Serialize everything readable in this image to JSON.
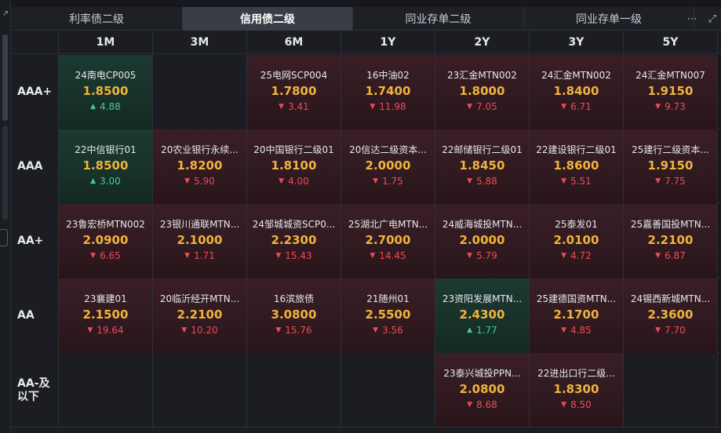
{
  "tabs": [
    {
      "label": "利率债二级",
      "active": false
    },
    {
      "label": "信用债二级",
      "active": true
    },
    {
      "label": "同业存单二级",
      "active": false
    },
    {
      "label": "同业存单一级",
      "active": false
    }
  ],
  "icons": {
    "more": "more-icon",
    "expand": "expand-icon",
    "corner": "corner-arrow-icon"
  },
  "colors": {
    "rate": "#f0b43c",
    "down": "#ef4b55",
    "up": "#3fd08a"
  },
  "columns": [
    "1M",
    "3M",
    "6M",
    "1Y",
    "2Y",
    "3Y",
    "5Y"
  ],
  "rows": [
    {
      "label": "AAA+",
      "cells": [
        {
          "name": "24南电CP005",
          "rate": "1.8500",
          "change": "4.88",
          "dir": "up"
        },
        null,
        {
          "name": "25电网SCP004",
          "rate": "1.7800",
          "change": "3.41",
          "dir": "down"
        },
        {
          "name": "16中油02",
          "rate": "1.7400",
          "change": "11.98",
          "dir": "down"
        },
        {
          "name": "23汇金MTN002",
          "rate": "1.8000",
          "change": "7.05",
          "dir": "down"
        },
        {
          "name": "24汇金MTN002",
          "rate": "1.8400",
          "change": "6.71",
          "dir": "down"
        },
        {
          "name": "24汇金MTN007",
          "rate": "1.9150",
          "change": "9.73",
          "dir": "down"
        }
      ]
    },
    {
      "label": "AAA",
      "cells": [
        {
          "name": "22中信银行01",
          "rate": "1.8500",
          "change": "3.00",
          "dir": "up"
        },
        {
          "name": "20农业银行永续...",
          "rate": "1.8200",
          "change": "5.90",
          "dir": "down"
        },
        {
          "name": "20中国银行二级01",
          "rate": "1.8100",
          "change": "4.00",
          "dir": "down"
        },
        {
          "name": "20信达二级资本...",
          "rate": "2.0000",
          "change": "1.75",
          "dir": "down"
        },
        {
          "name": "22邮储银行二级01",
          "rate": "1.8450",
          "change": "5.88",
          "dir": "down"
        },
        {
          "name": "22建设银行二级01",
          "rate": "1.8600",
          "change": "5.51",
          "dir": "down"
        },
        {
          "name": "25建行二级资本...",
          "rate": "1.9150",
          "change": "7.75",
          "dir": "down"
        }
      ]
    },
    {
      "label": "AA+",
      "cells": [
        {
          "name": "23鲁宏桥MTN002",
          "rate": "2.0900",
          "change": "6.65",
          "dir": "down"
        },
        {
          "name": "23银川通联MTN...",
          "rate": "2.1000",
          "change": "1.71",
          "dir": "down"
        },
        {
          "name": "24邹城城资SCP0...",
          "rate": "2.2300",
          "change": "15.43",
          "dir": "down"
        },
        {
          "name": "25湖北广电MTN...",
          "rate": "2.7000",
          "change": "14.45",
          "dir": "down"
        },
        {
          "name": "24威海城投MTN...",
          "rate": "2.0000",
          "change": "5.79",
          "dir": "down"
        },
        {
          "name": "25泰发01",
          "rate": "2.0100",
          "change": "4.72",
          "dir": "down"
        },
        {
          "name": "25嘉善国投MTN...",
          "rate": "2.2100",
          "change": "6.87",
          "dir": "down"
        }
      ]
    },
    {
      "label": "AA",
      "cells": [
        {
          "name": "23襄建01",
          "rate": "2.1500",
          "change": "19.64",
          "dir": "down"
        },
        {
          "name": "20临沂经开MTN...",
          "rate": "2.2100",
          "change": "10.20",
          "dir": "down"
        },
        {
          "name": "16滨旅债",
          "rate": "3.0800",
          "change": "15.76",
          "dir": "down"
        },
        {
          "name": "21随州01",
          "rate": "2.5500",
          "change": "3.56",
          "dir": "down"
        },
        {
          "name": "23资阳发展MTN...",
          "rate": "2.4300",
          "change": "1.77",
          "dir": "up"
        },
        {
          "name": "25建德国资MTN...",
          "rate": "2.1700",
          "change": "4.85",
          "dir": "down"
        },
        {
          "name": "24锡西新城MTN...",
          "rate": "2.3600",
          "change": "7.70",
          "dir": "down"
        }
      ]
    },
    {
      "label": "AA-及以下",
      "cells": [
        null,
        null,
        null,
        null,
        {
          "name": "23泰兴城投PPN...",
          "rate": "2.0800",
          "change": "8.68",
          "dir": "down"
        },
        {
          "name": "22进出口行二级...",
          "rate": "1.8300",
          "change": "8.50",
          "dir": "down"
        },
        null
      ]
    }
  ]
}
